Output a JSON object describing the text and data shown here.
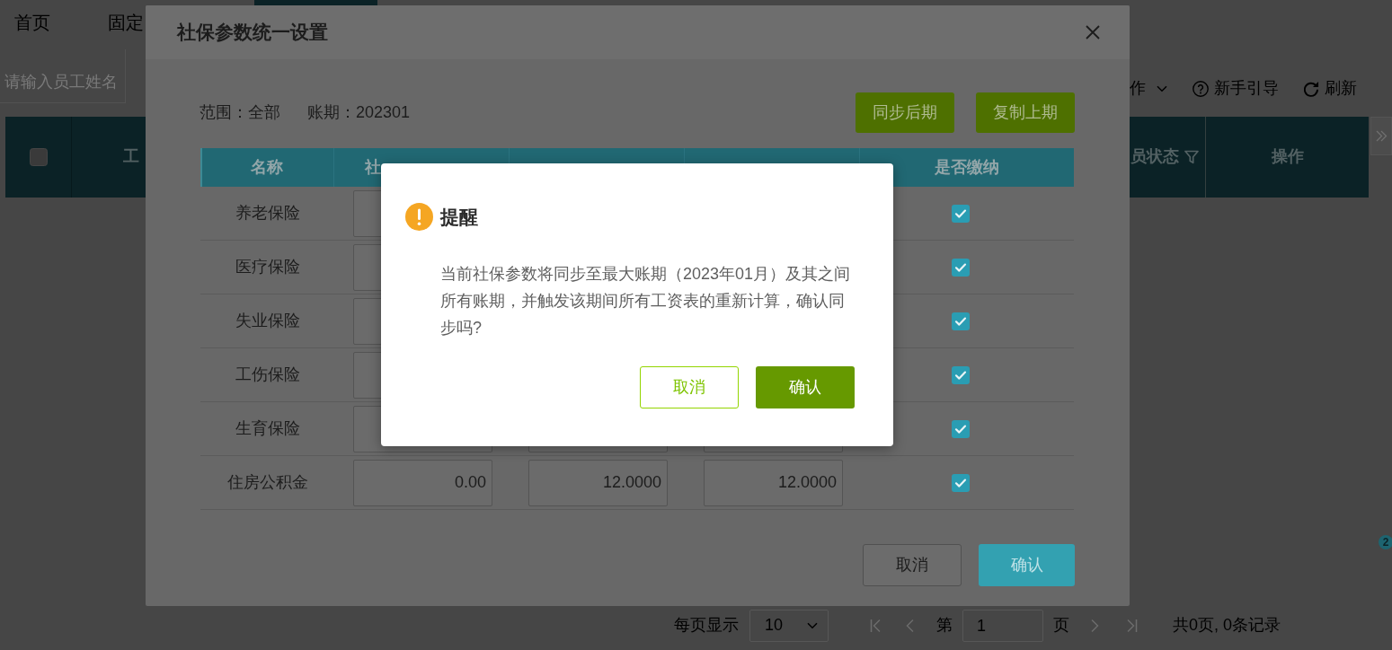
{
  "page": {
    "tabs": [
      {
        "label": "首页",
        "selected": false
      },
      {
        "label": "固定",
        "selected": false
      },
      {
        "selected": true
      }
    ],
    "search": {
      "placeholder": "请输入员工姓名"
    },
    "toolbar": [
      {
        "kind": "menu",
        "label": "作"
      },
      {
        "kind": "help",
        "label": "新手引导"
      },
      {
        "kind": "refresh",
        "label": "刷新"
      }
    ],
    "table": {
      "columns": [
        {
          "kind": "checkbox",
          "checked": false
        },
        {
          "kind": "text",
          "label": "工"
        },
        {
          "kind": "filter",
          "label": "员状态"
        },
        {
          "kind": "text",
          "label": "操作"
        }
      ]
    },
    "badge": "2",
    "pagination": {
      "per_page_label": "每页显示",
      "per_page": "10",
      "page_prefix": "第",
      "page": "1",
      "page_suffix": "页",
      "summary": "共0页, 0条记录"
    }
  },
  "modal": {
    "title": "社保参数统一设置",
    "scope": "范围：全部",
    "period": "账期：202301",
    "actions": [
      "同步后期",
      "复制上期"
    ],
    "table": {
      "columns": [
        {
          "kind": "name",
          "label": "名称"
        },
        {
          "kind": "input",
          "label": "社"
        },
        {
          "kind": "input"
        },
        {
          "kind": "input"
        },
        {
          "kind": "check",
          "label": "是否缴纳"
        }
      ],
      "rows": [
        {
          "name": "养老保险",
          "paid": true
        },
        {
          "name": "医疗保险",
          "paid": true
        },
        {
          "name": "失业保险",
          "paid": true
        },
        {
          "name": "工伤保险",
          "paid": true
        },
        {
          "name": "生育保险",
          "paid": true
        },
        {
          "name": "住房公积金",
          "values": [
            "0.00",
            "12.0000",
            "12.0000"
          ],
          "paid": true
        }
      ]
    },
    "buttons": [
      {
        "kind": "secondary",
        "label": "取消"
      },
      {
        "kind": "primary",
        "label": "确认"
      }
    ]
  },
  "alert": {
    "title": "提醒",
    "message": "当前社保参数将同步至最大账期（2023年01月）及其之间所有账期，并触发该期间所有工资表的重新计算，确认同步吗?",
    "buttons": [
      {
        "kind": "secondary",
        "label": "取消"
      },
      {
        "kind": "primary",
        "label": "确认"
      }
    ]
  }
}
